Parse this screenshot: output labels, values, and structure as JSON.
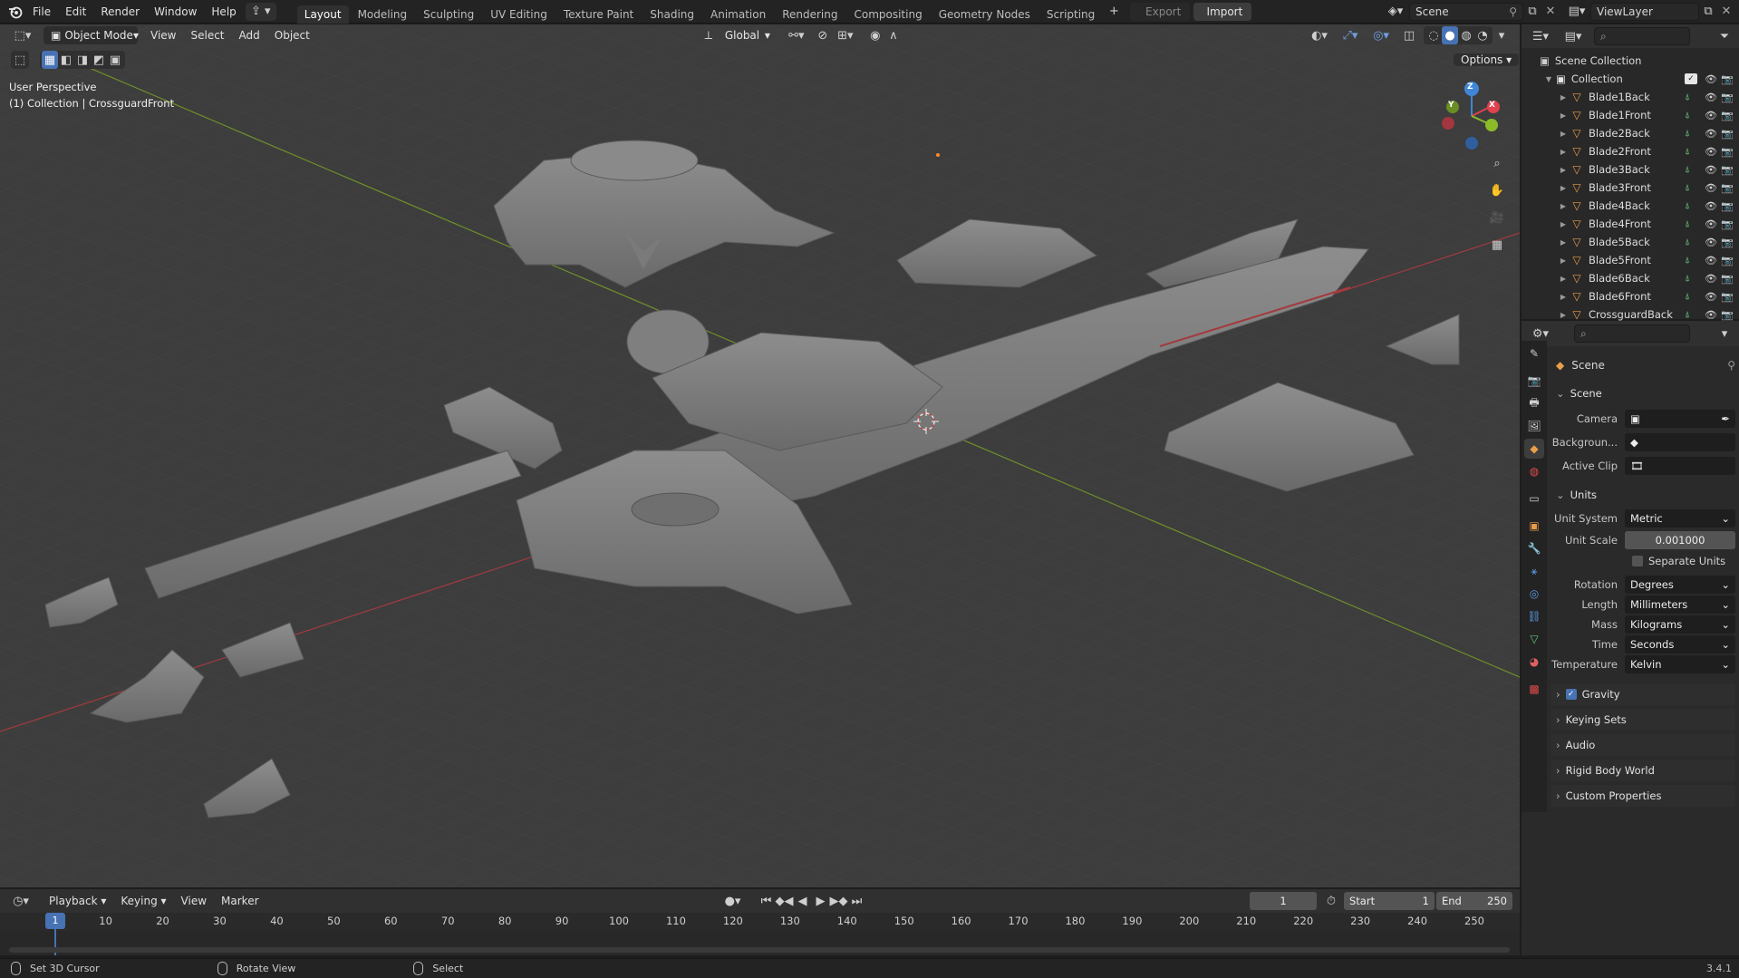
{
  "topbar": {
    "menus": [
      "File",
      "Edit",
      "Render",
      "Window",
      "Help"
    ],
    "workspaces": [
      "Layout",
      "Modeling",
      "Sculpting",
      "UV Editing",
      "Texture Paint",
      "Shading",
      "Animation",
      "Rendering",
      "Compositing",
      "Geometry Nodes",
      "Scripting"
    ],
    "active_workspace": "Layout",
    "export_label": "Export",
    "import_label": "Import",
    "scene_name": "Scene",
    "view_layer": "ViewLayer"
  },
  "viewport": {
    "mode": "Object Mode",
    "menus": [
      "View",
      "Select",
      "Add",
      "Object"
    ],
    "transform_orientation": "Global",
    "options_label": "Options",
    "perspective_label": "User Perspective",
    "collection_label": "(1) Collection | CrossguardFront",
    "gizmo_axes": {
      "x": "X",
      "y": "Y",
      "z": "Z"
    }
  },
  "outliner": {
    "root": "Scene Collection",
    "collection": "Collection",
    "items": [
      "Blade1Back",
      "Blade1Front",
      "Blade2Back",
      "Blade2Front",
      "Blade3Back",
      "Blade3Front",
      "Blade4Back",
      "Blade4Front",
      "Blade5Back",
      "Blade5Front",
      "Blade6Back",
      "Blade6Front",
      "CrossguardBack"
    ]
  },
  "properties": {
    "context_title": "Scene",
    "scene_panel": {
      "title": "Scene",
      "camera_label": "Camera",
      "background_label": "Backgroun...",
      "active_clip_label": "Active Clip"
    },
    "units_panel": {
      "title": "Units",
      "unit_system_label": "Unit System",
      "unit_system": "Metric",
      "unit_scale_label": "Unit Scale",
      "unit_scale": "0.001000",
      "separate_units": "Separate Units",
      "rotation_label": "Rotation",
      "rotation": "Degrees",
      "length_label": "Length",
      "length": "Millimeters",
      "mass_label": "Mass",
      "mass": "Kilograms",
      "time_label": "Time",
      "time": "Seconds",
      "temperature_label": "Temperature",
      "temperature": "Kelvin"
    },
    "collapsed_panels": [
      "Gravity",
      "Keying Sets",
      "Audio",
      "Rigid Body World",
      "Custom Properties"
    ],
    "gravity_checked": true
  },
  "timeline": {
    "menus": [
      "Playback",
      "Keying",
      "View",
      "Marker"
    ],
    "current_frame": "1",
    "start_label": "Start",
    "start_value": "1",
    "end_label": "End",
    "end_value": "250",
    "ruler": [
      "1",
      "10",
      "20",
      "30",
      "40",
      "50",
      "60",
      "70",
      "80",
      "90",
      "100",
      "110",
      "120",
      "130",
      "140",
      "150",
      "160",
      "170",
      "180",
      "190",
      "200",
      "210",
      "220",
      "230",
      "240",
      "250"
    ]
  },
  "status": {
    "hints": [
      "Set 3D Cursor",
      "Rotate View",
      "Select"
    ],
    "version": "3.4.1"
  },
  "colors": {
    "accent": "#4772b3",
    "mesh_icon": "#e79b4a",
    "x_axis": "#e0424e",
    "y_axis": "#8cbb2a",
    "z_axis": "#3f86d8"
  }
}
